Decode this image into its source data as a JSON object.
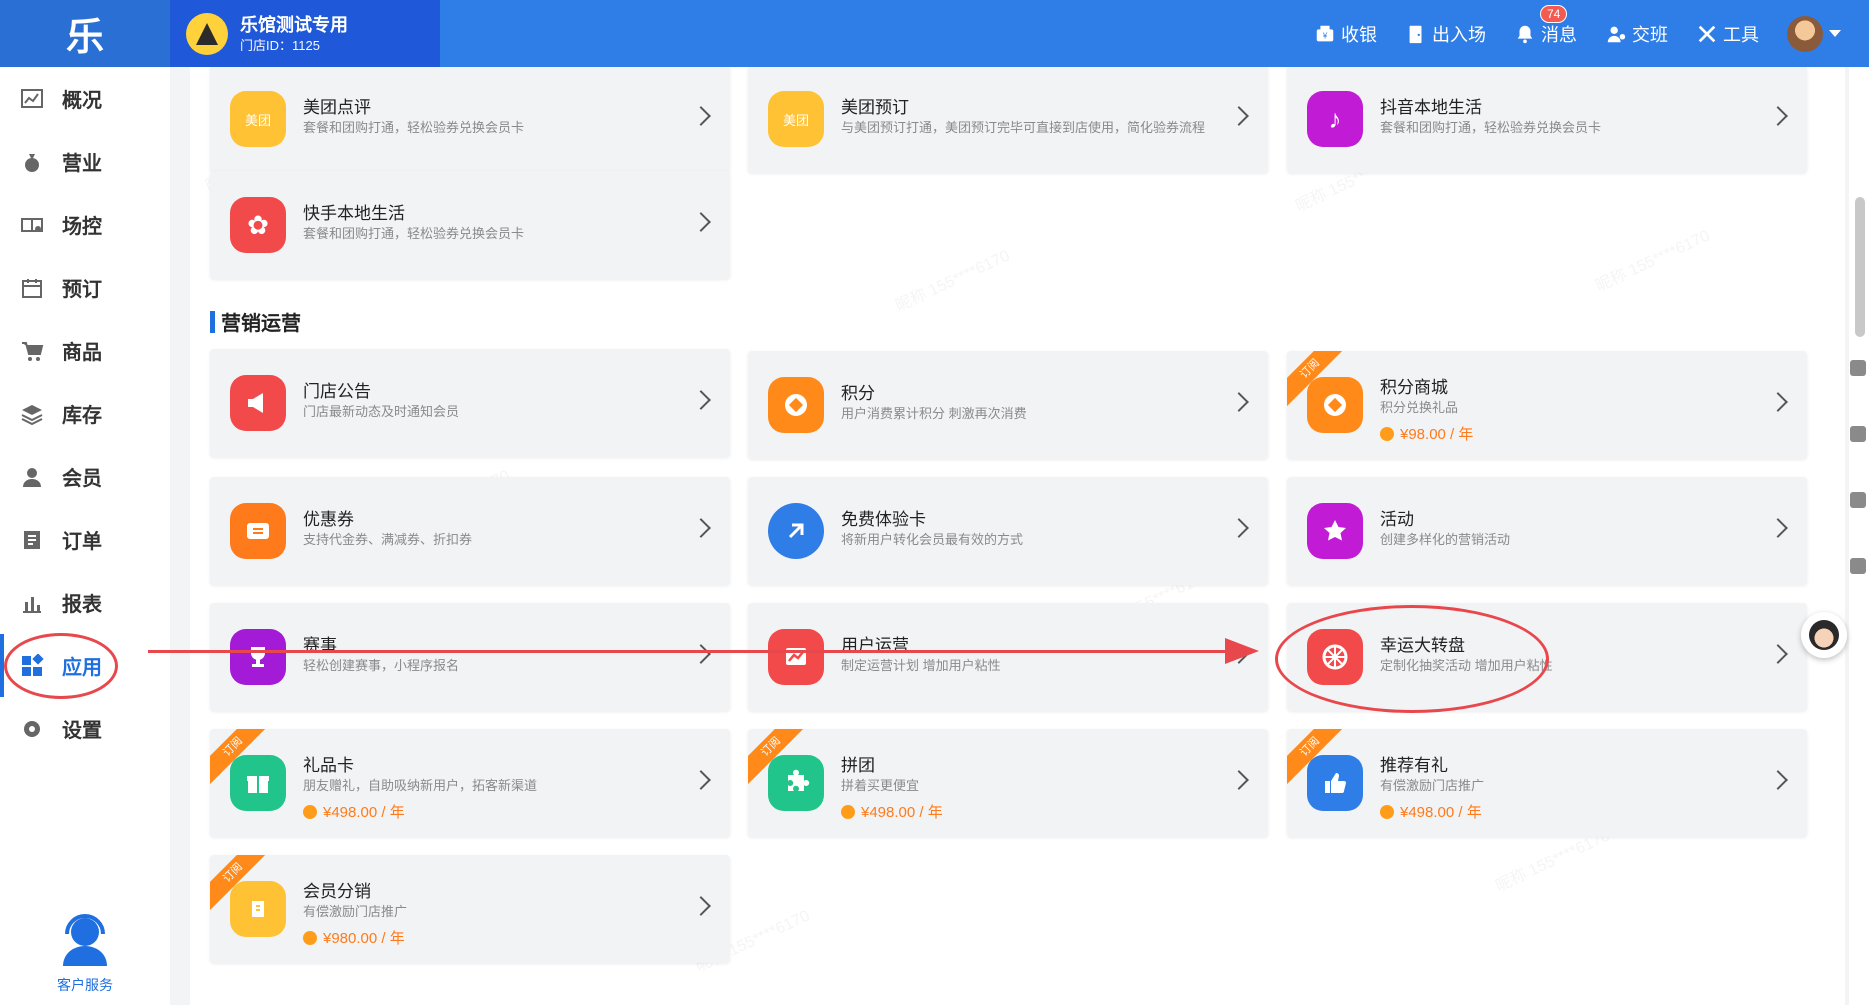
{
  "app": {
    "logo_text": "乐",
    "store_name": "乐馆测试专用",
    "store_id": "门店ID：1125"
  },
  "top_actions": [
    {
      "label": "收银",
      "icon": "cashier-icon"
    },
    {
      "label": "出入场",
      "icon": "door-icon"
    },
    {
      "label": "消息",
      "icon": "bell-icon",
      "badge": "74"
    },
    {
      "label": "交班",
      "icon": "handover-icon"
    },
    {
      "label": "工具",
      "icon": "tools-icon"
    }
  ],
  "sidebar": {
    "items": [
      {
        "label": "概况",
        "icon": "chart-icon"
      },
      {
        "label": "营业",
        "icon": "moneybag-icon"
      },
      {
        "label": "场控",
        "icon": "court-icon"
      },
      {
        "label": "预订",
        "icon": "calendar-icon"
      },
      {
        "label": "商品",
        "icon": "cart-icon"
      },
      {
        "label": "库存",
        "icon": "stack-icon"
      },
      {
        "label": "会员",
        "icon": "user-icon"
      },
      {
        "label": "订单",
        "icon": "order-icon"
      },
      {
        "label": "报表",
        "icon": "bar-chart-icon"
      },
      {
        "label": "应用",
        "icon": "apps-icon",
        "active": true
      },
      {
        "label": "设置",
        "icon": "gear-icon"
      }
    ],
    "support_label": "客户服务"
  },
  "watermark_text": "昵称 155****6170",
  "integrations": [
    {
      "title": "美团点评",
      "desc": "套餐和团购打通，轻松验券兑换会员卡",
      "color": "#ffc234",
      "icon_text": "美团"
    },
    {
      "title": "美团预订",
      "desc": "与美团预订打通，美团预订完毕可直接到店使用，简化验券流程",
      "color": "#ffc234",
      "icon_text": "美团"
    },
    {
      "title": "抖音本地生活",
      "desc": "套餐和团购打通，轻松验券兑换会员卡",
      "color": "#c21bd6",
      "icon_text": "♪"
    },
    {
      "title": "快手本地生活",
      "desc": "套餐和团购打通，轻松验券兑换会员卡",
      "color": "#f24a4a",
      "icon_text": "✿"
    }
  ],
  "section": {
    "title": "营销运营"
  },
  "marketing": [
    {
      "title": "门店公告",
      "desc": "门店最新动态及时通知会员",
      "color": "#f24a4a",
      "icon": "megaphone-icon"
    },
    {
      "title": "积分",
      "desc": "用户消费累计积分 刺激再次消费",
      "color": "#ff8a1a",
      "icon": "points-icon"
    },
    {
      "title": "积分商城",
      "desc": "积分兑换礼品",
      "color": "#ff8a1a",
      "icon": "points-mall-icon",
      "price": "¥98.00 / 年",
      "ribbon": "订阅"
    },
    {
      "title": "优惠券",
      "desc": "支持代金券、满减券、折扣券",
      "color": "#ff7a1a",
      "icon": "coupon-icon"
    },
    {
      "title": "免费体验卡",
      "desc": "将新用户转化会员最有效的方式",
      "color": "#2f7de6",
      "icon": "trial-card-icon"
    },
    {
      "title": "活动",
      "desc": "创建多样化的营销活动",
      "color": "#c21bd6",
      "icon": "star-icon"
    },
    {
      "title": "赛事",
      "desc": "轻松创建赛事，小程序报名",
      "color": "#a31bd6",
      "icon": "trophy-icon"
    },
    {
      "title": "用户运营",
      "desc": "制定运营计划 增加用户粘性",
      "color": "#f24a4a",
      "icon": "trend-icon"
    },
    {
      "title": "幸运大转盘",
      "desc": "定制化抽奖活动 增加用户粘性",
      "color": "#f24a4a",
      "icon": "wheel-icon"
    },
    {
      "title": "礼品卡",
      "desc": "朋友赠礼，自助吸纳新用户，拓客新渠道",
      "color": "#21c48a",
      "icon": "gift-icon",
      "price": "¥498.00 / 年",
      "ribbon": "订阅"
    },
    {
      "title": "拼团",
      "desc": "拼着买更便宜",
      "color": "#21c48a",
      "icon": "puzzle-icon",
      "price": "¥498.00 / 年",
      "ribbon": "订阅"
    },
    {
      "title": "推荐有礼",
      "desc": "有偿激励门店推广",
      "color": "#2f7de6",
      "icon": "thumbs-up-icon",
      "price": "¥498.00 / 年",
      "ribbon": "订阅"
    },
    {
      "title": "会员分销",
      "desc": "有偿激励门店推广",
      "color": "#ffc234",
      "icon": "distribution-icon",
      "price": "¥980.00 / 年",
      "ribbon": "订阅"
    }
  ],
  "colors": {
    "primary": "#2f7de6",
    "annotation": "#e8484c",
    "price": "#ff7a1a"
  }
}
